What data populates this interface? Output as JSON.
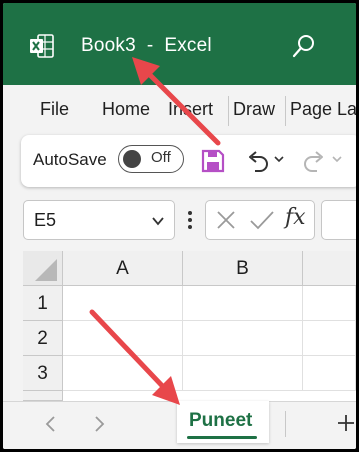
{
  "titlebar": {
    "title": "Book3  -  Excel",
    "app_icon": "excel-logo",
    "search_icon": "search-icon"
  },
  "ribbon_tabs": [
    {
      "label": "File"
    },
    {
      "label": "Home"
    },
    {
      "label": "Insert"
    },
    {
      "label": "Draw"
    },
    {
      "label": "Page La"
    }
  ],
  "quick_access": {
    "autosave_label": "AutoSave",
    "autosave_state": "Off",
    "save_icon": "save-icon",
    "undo_icon": "undo-icon",
    "redo_icon": "redo-icon"
  },
  "formula_bar": {
    "name_box": "E5",
    "fx_label": "fx"
  },
  "grid": {
    "columns": [
      "A",
      "B"
    ],
    "rows": [
      "1",
      "2",
      "3"
    ]
  },
  "sheet_tabs": {
    "active": "Puneet",
    "add_label": "+"
  },
  "colors": {
    "brand_green": "#1e7145",
    "annotation_arrow": "#e8474b",
    "save_icon": "#b54fc5"
  }
}
